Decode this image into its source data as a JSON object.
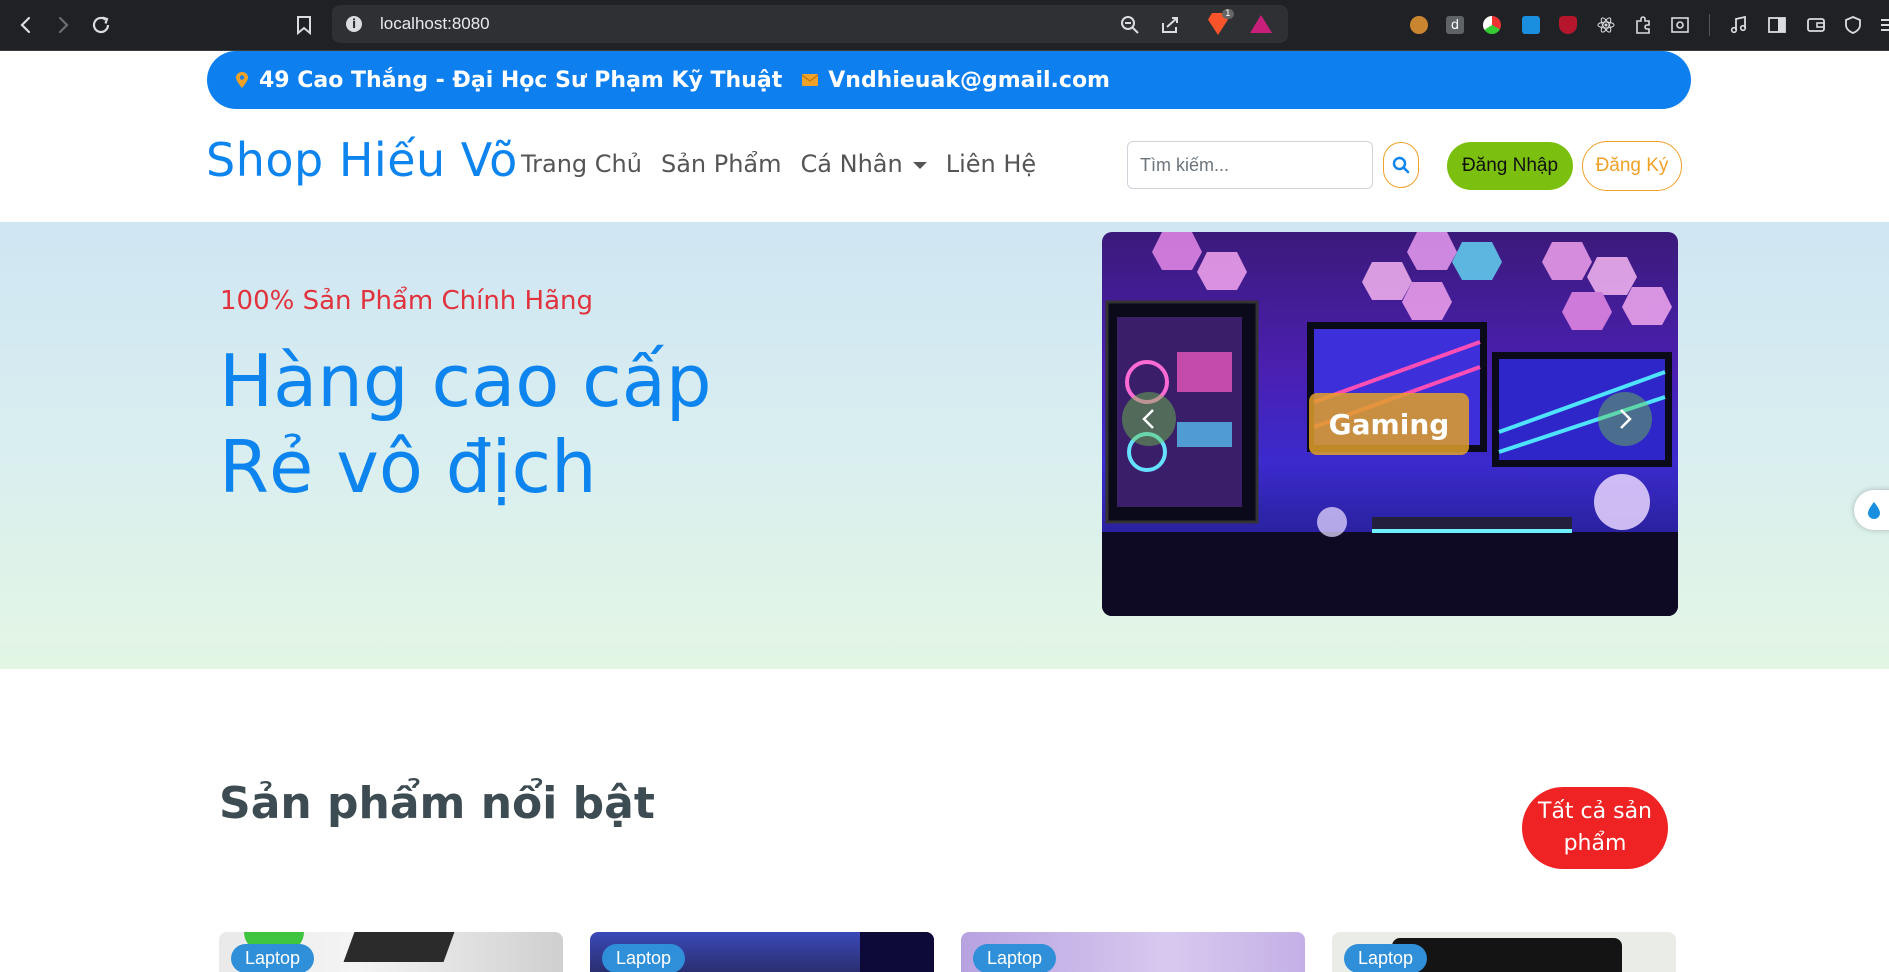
{
  "browser": {
    "url": "localhost:8080",
    "shield_badge": "1"
  },
  "topbar": {
    "address": "49 Cao Thắng - Đại Học Sư Phạm Kỹ Thuật",
    "email": "Vndhieuak@gmail.com"
  },
  "header": {
    "brand": "Shop Hiếu Võ",
    "nav": [
      "Trang Chủ",
      "Sản Phẩm",
      "Cá Nhân",
      "Liên Hệ"
    ],
    "search_placeholder": "Tìm kiếm...",
    "login_label": "Đăng Nhập",
    "register_label": "Đăng Ký"
  },
  "hero": {
    "subtitle": "100% Sản Phẩm Chính Hãng",
    "title_line1": "Hàng cao cấp",
    "title_line2": "Rẻ vô địch",
    "slide_label": "Gaming"
  },
  "featured": {
    "title": "Sản phẩm nổi bật",
    "all_button": "Tất cả sản phẩm",
    "cards": [
      {
        "tag": "Laptop"
      },
      {
        "tag": "Laptop"
      },
      {
        "tag": "Laptop"
      },
      {
        "tag": "Laptop"
      }
    ]
  },
  "colors": {
    "primary": "#0d84ee",
    "accent_orange": "#f0a127",
    "login_green": "#7cc00f",
    "all_button_red": "#ef2323",
    "hero_subtitle_red": "#e0333d"
  },
  "icons": {
    "back": "back-arrow-icon",
    "forward": "forward-arrow-icon",
    "reload": "reload-icon",
    "bookmark": "bookmark-icon",
    "location": "map-marker-icon",
    "email": "envelope-icon",
    "search": "search-icon"
  }
}
